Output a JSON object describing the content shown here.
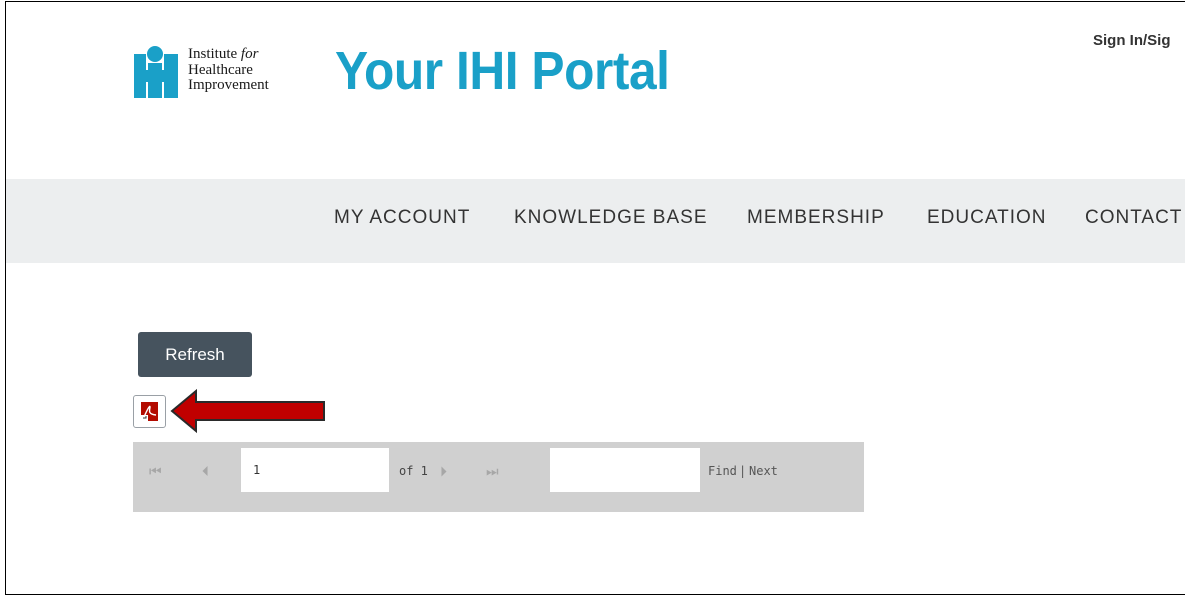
{
  "header": {
    "logo": {
      "line1": "Institute",
      "line1_italic": "for",
      "line2": "Healthcare",
      "line3": "Improvement",
      "color": "#1aa0c8"
    },
    "portal_title": "Your IHI Portal",
    "signin_label": "Sign In/Sig"
  },
  "nav": {
    "items": [
      {
        "label": "MY ACCOUNT"
      },
      {
        "label": "KNOWLEDGE BASE"
      },
      {
        "label": "MEMBERSHIP"
      },
      {
        "label": "EDUCATION"
      },
      {
        "label": "CONTACT"
      }
    ]
  },
  "report": {
    "refresh_label": "Refresh",
    "export_icon": "pdf-export-icon",
    "annotation_arrow_color": "#c00000",
    "toolbar": {
      "first_page_icon": "first-page-icon",
      "prev_page_icon": "previous-page-icon",
      "current_page": "1",
      "of_label": "of 1",
      "next_page_icon": "next-page-icon",
      "last_page_icon": "last-page-icon",
      "find_value": "",
      "find_label": "Find",
      "separator": "|",
      "next_label": "Next"
    }
  }
}
